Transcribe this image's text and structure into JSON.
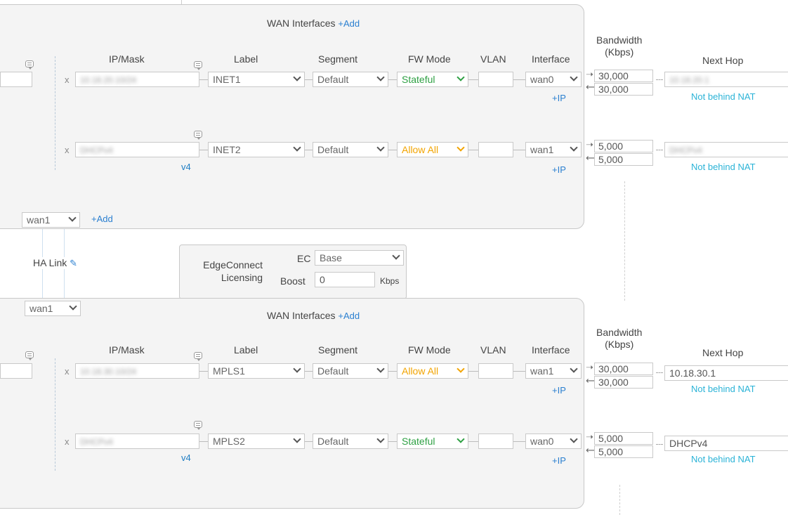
{
  "top_panel": {
    "title": "WAN Interfaces",
    "add_label": "+Add",
    "bandwidth_header": "Bandwidth\n(Kbps)",
    "columns": {
      "ip_mask": "IP/Mask",
      "label": "Label",
      "segment": "Segment",
      "fw_mode": "FW Mode",
      "vlan": "VLAN",
      "interface": "Interface",
      "bandwidth_line1": "Bandwidth",
      "bandwidth_line2": "(Kbps)",
      "next_hop": "Next Hop"
    },
    "rows": [
      {
        "remove": "x",
        "ip_value": "10.18.20.10/24",
        "label": "INET1",
        "segment": "Default",
        "fw_mode": "Stateful",
        "vlan": "",
        "interface": "wan0",
        "add_ip": "+IP",
        "bw_out": "30,000",
        "bw_in": "30,000",
        "next_hop": "10.18.20.1",
        "nat": "Not behind NAT",
        "v4": ""
      },
      {
        "remove": "x",
        "ip_value": "DHCPv4",
        "label": "INET2",
        "segment": "Default",
        "fw_mode": "Allow All",
        "vlan": "",
        "interface": "wan1",
        "add_ip": "+IP",
        "bw_out": "5,000",
        "bw_in": "5,000",
        "next_hop": "DHCPv4",
        "nat": "Not behind NAT",
        "v4": "v4"
      }
    ],
    "bottom_select": "wan1",
    "bottom_add": "+Add"
  },
  "ha_link": {
    "label": "HA Link"
  },
  "licensing": {
    "title_line1": "EdgeConnect",
    "title_line2": "Licensing",
    "ec_label": "EC",
    "ec_value": "Base",
    "boost_label": "Boost",
    "boost_value": "0",
    "boost_unit": "Kbps"
  },
  "bottom_panel": {
    "top_select": "wan1",
    "title": "WAN Interfaces",
    "add_label": "+Add",
    "columns": {
      "ip_mask": "IP/Mask",
      "label": "Label",
      "segment": "Segment",
      "fw_mode": "FW Mode",
      "vlan": "VLAN",
      "interface": "Interface",
      "bandwidth_line1": "Bandwidth",
      "bandwidth_line2": "(Kbps)",
      "next_hop": "Next Hop"
    },
    "rows": [
      {
        "remove": "x",
        "ip_value": "10.18.30.10/24",
        "label": "MPLS1",
        "segment": "Default",
        "fw_mode": "Allow All",
        "vlan": "",
        "interface": "wan1",
        "add_ip": "+IP",
        "bw_out": "30,000",
        "bw_in": "30,000",
        "next_hop": "10.18.30.1",
        "nat": "Not behind NAT",
        "v4": ""
      },
      {
        "remove": "x",
        "ip_value": "DHCPv4",
        "label": "MPLS2",
        "segment": "Default",
        "fw_mode": "Stateful",
        "vlan": "",
        "interface": "wan0",
        "add_ip": "+IP",
        "bw_out": "5,000",
        "bw_in": "5,000",
        "next_hop": "DHCPv4",
        "nat": "Not behind NAT",
        "v4": "v4"
      }
    ]
  },
  "icons": {
    "note": "note-icon",
    "pencil": "pencil-icon",
    "chevron": "chevron-down-icon",
    "arrow_out": "arrow-right-icon",
    "arrow_in": "arrow-left-icon"
  },
  "colors": {
    "link": "#2a7fd0",
    "nat": "#2bb3d7",
    "stateful": "#2ea043",
    "allow_all": "#f2a400"
  }
}
